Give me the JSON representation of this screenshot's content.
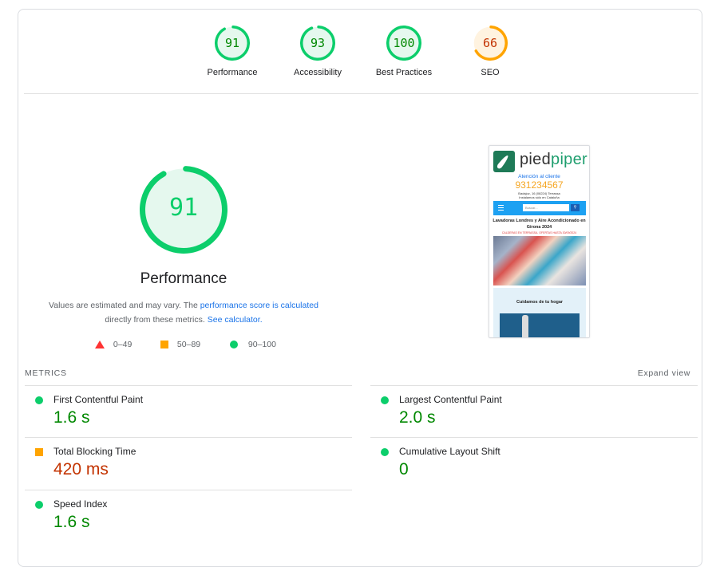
{
  "colors": {
    "pass": "#0cce6b",
    "pass_text": "#008800",
    "pass_bg": "#e5f8ee",
    "average": "#ffa400",
    "average_text": "#c33300",
    "average_bg": "#fff3e0",
    "fail": "#ff3333",
    "link": "#1a73e8"
  },
  "categories": [
    {
      "label": "Performance",
      "score": "91",
      "rating": "pass",
      "fraction": 0.91
    },
    {
      "label": "Accessibility",
      "score": "93",
      "rating": "pass",
      "fraction": 0.93
    },
    {
      "label": "Best Practices",
      "score": "100",
      "rating": "pass",
      "fraction": 1.0
    },
    {
      "label": "SEO",
      "score": "66",
      "rating": "average",
      "fraction": 0.66
    }
  ],
  "main": {
    "score": "91",
    "fraction": 0.91,
    "title": "Performance",
    "desc_prefix": "Values are estimated and may vary. The ",
    "desc_link1": "performance score is calculated",
    "desc_middle": " directly from these metrics. ",
    "desc_link2": "See calculator.",
    "legend": [
      {
        "icon": "triangle-icon",
        "range": "0–49"
      },
      {
        "icon": "square-icon",
        "range": "50–89"
      },
      {
        "icon": "circle-icon",
        "range": "90–100"
      }
    ]
  },
  "screenshot": {
    "brand_a": "pied",
    "brand_b": "piper",
    "attention": "Atención al cliente",
    "phone": "931234567",
    "address_line1": "Badajoz, 16 (08224) Terrassa",
    "address_line2": "Instalamos sólo en Cataluña",
    "search_placeholder": "Buscar...",
    "headline": "Lavadoras Londres y Aire Acondicionado en Girona 2024",
    "promo": "CALDERAS EN TERRASSA. OFERTAS HASTA 30/09/2024",
    "section_title": "Cuidamos de tu hogar"
  },
  "metrics": {
    "heading": "METRICS",
    "expand_label": "Expand view",
    "items": [
      {
        "name": "First Contentful Paint",
        "value": "1.6 s",
        "rating": "pass"
      },
      {
        "name": "Largest Contentful Paint",
        "value": "2.0 s",
        "rating": "pass"
      },
      {
        "name": "Total Blocking Time",
        "value": "420 ms",
        "rating": "average"
      },
      {
        "name": "Cumulative Layout Shift",
        "value": "0",
        "rating": "pass"
      },
      {
        "name": "Speed Index",
        "value": "1.6 s",
        "rating": "pass"
      }
    ]
  }
}
